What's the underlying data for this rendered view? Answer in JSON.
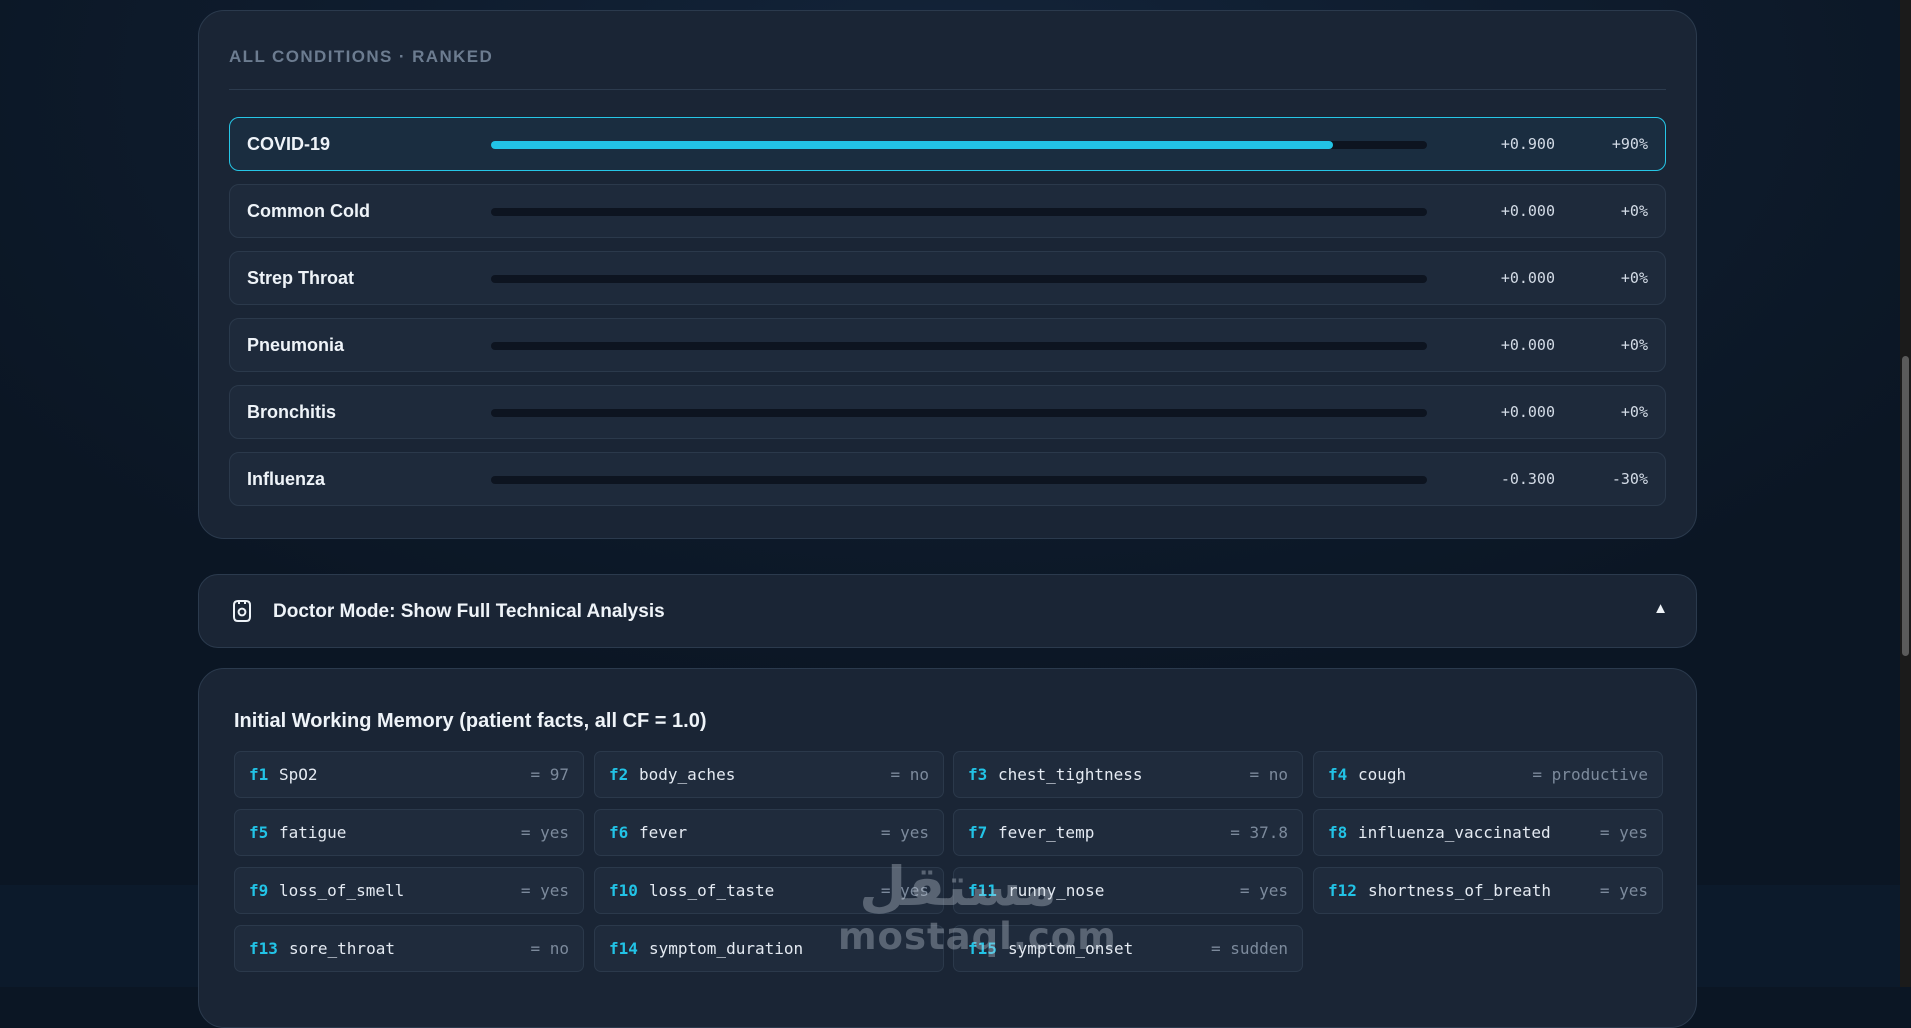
{
  "ranked": {
    "section_label": "ALL CONDITIONS · RANKED",
    "conditions": [
      {
        "name": "COVID-19",
        "cf": "+0.900",
        "pct": "+90%",
        "fill": 0.9,
        "top": true
      },
      {
        "name": "Common Cold",
        "cf": "+0.000",
        "pct": "+0%",
        "fill": 0,
        "top": false
      },
      {
        "name": "Strep Throat",
        "cf": "+0.000",
        "pct": "+0%",
        "fill": 0,
        "top": false
      },
      {
        "name": "Pneumonia",
        "cf": "+0.000",
        "pct": "+0%",
        "fill": 0,
        "top": false
      },
      {
        "name": "Bronchitis",
        "cf": "+0.000",
        "pct": "+0%",
        "fill": 0,
        "top": false
      },
      {
        "name": "Influenza",
        "cf": "-0.300",
        "pct": "-30%",
        "fill": 0,
        "top": false
      }
    ]
  },
  "doctor_mode": {
    "title": "Doctor Mode: Show Full Technical Analysis",
    "caret": "▲",
    "icon": "badge-icon"
  },
  "working_memory": {
    "title": "Initial Working Memory (patient facts, all CF = 1.0)",
    "facts": [
      {
        "id": "f1",
        "name": "SpO2",
        "value": "= 97"
      },
      {
        "id": "f2",
        "name": "body_aches",
        "value": "= no"
      },
      {
        "id": "f3",
        "name": "chest_tightness",
        "value": "= no"
      },
      {
        "id": "f4",
        "name": "cough",
        "value": "= productive"
      },
      {
        "id": "f5",
        "name": "fatigue",
        "value": "= yes"
      },
      {
        "id": "f6",
        "name": "fever",
        "value": "= yes"
      },
      {
        "id": "f7",
        "name": "fever_temp",
        "value": "= 37.8"
      },
      {
        "id": "f8",
        "name": "influenza_vaccinated",
        "value": "= yes"
      },
      {
        "id": "f9",
        "name": "loss_of_smell",
        "value": "= yes"
      },
      {
        "id": "f10",
        "name": "loss_of_taste",
        "value": "= yes"
      },
      {
        "id": "f11",
        "name": "runny_nose",
        "value": "= yes"
      },
      {
        "id": "f12",
        "name": "shortness_of_breath",
        "value": "= yes"
      },
      {
        "id": "f13",
        "name": "sore_throat",
        "value": "= no"
      },
      {
        "id": "f14",
        "name": "symptom_duration",
        "value": ""
      },
      {
        "id": "f15",
        "name": "symptom_onset",
        "value": "= sudden"
      }
    ]
  },
  "watermark": {
    "arabic": "مستقل",
    "latin": "mostaql.com"
  },
  "colors": {
    "accent": "#22c3e6",
    "card": "#1a2535",
    "background": "#0b1624"
  }
}
